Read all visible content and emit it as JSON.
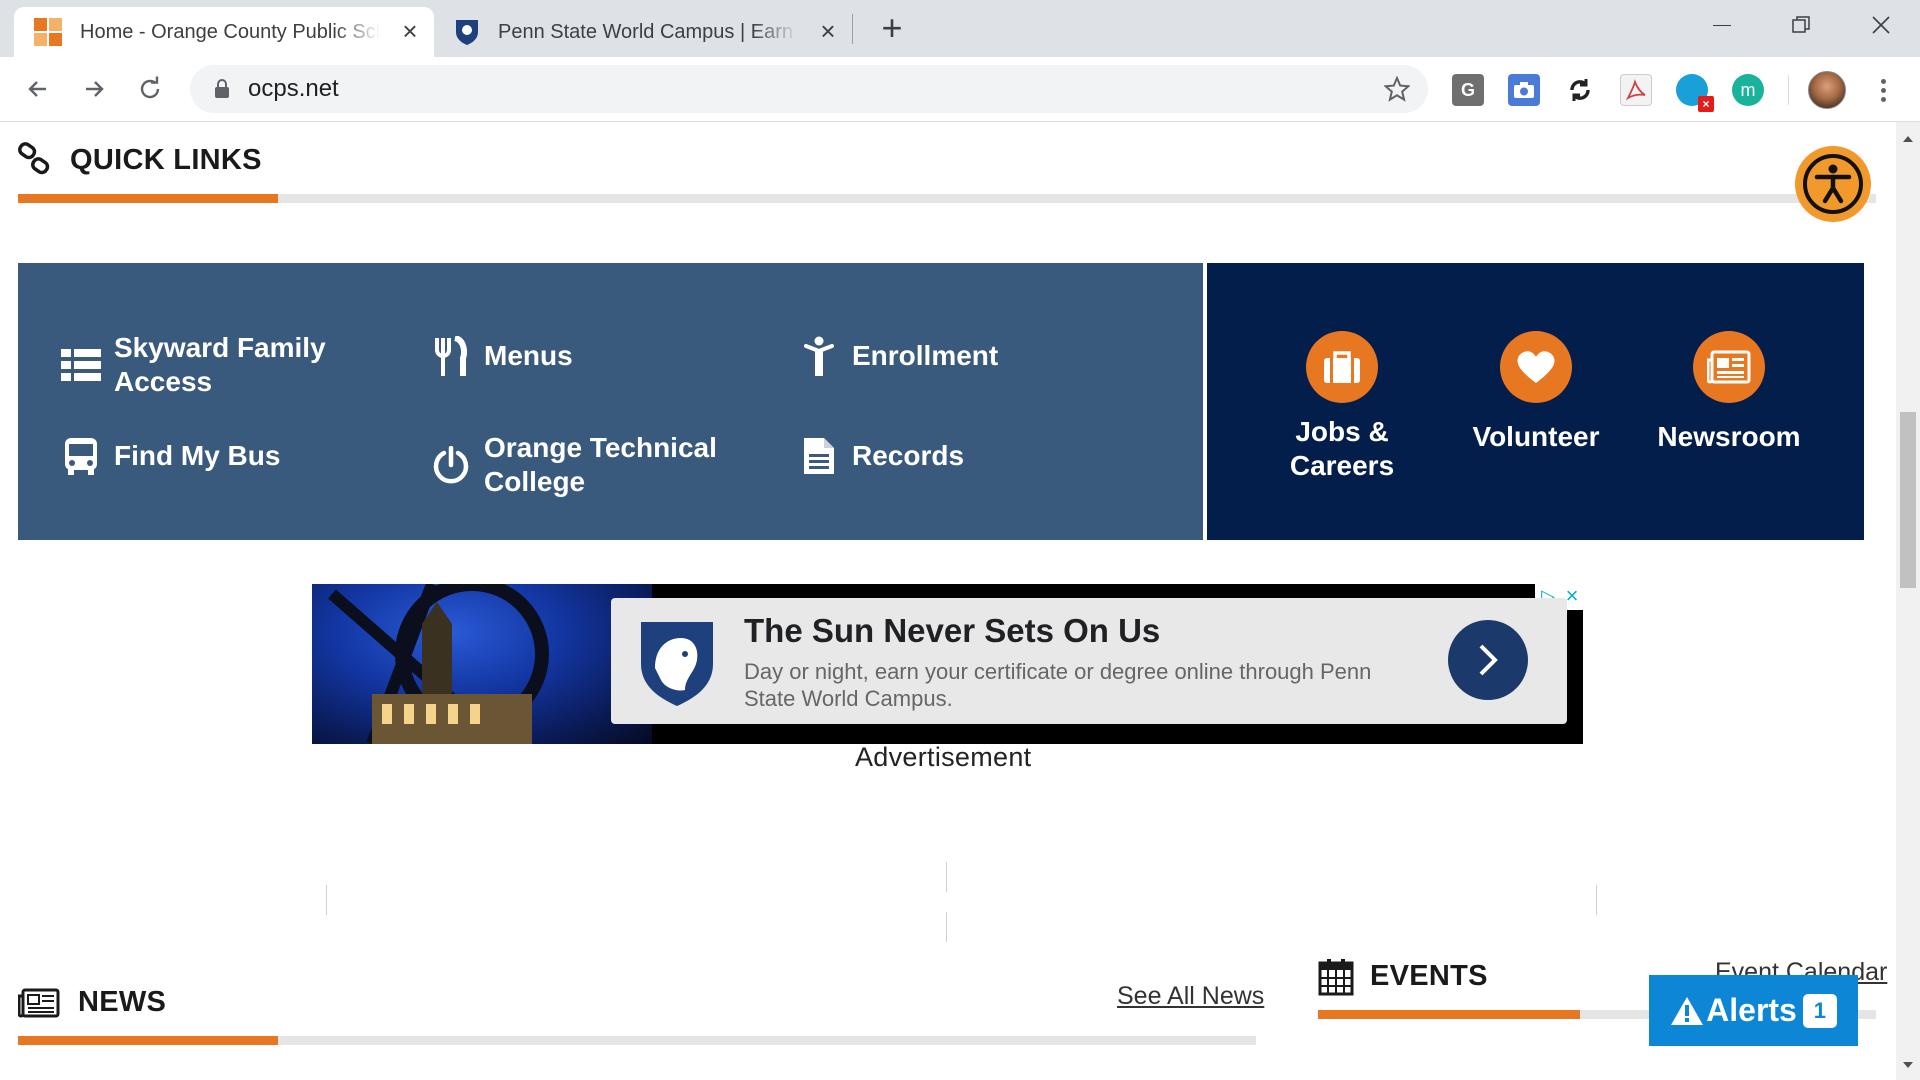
{
  "browser": {
    "tabs": [
      {
        "title": "Home - Orange County Public Schools",
        "active": true
      },
      {
        "title": "Penn State World Campus | Earn Your Degree",
        "active": false
      }
    ],
    "new_tab_label": "+",
    "url": "ocps.net"
  },
  "extensions": [
    {
      "name": "G",
      "color": "#6f6f6f"
    },
    {
      "name": "camera",
      "color": "#4a7bd6"
    },
    {
      "name": "sync",
      "color": "#222222"
    },
    {
      "name": "pdf",
      "color": "#d04242"
    },
    {
      "name": "ext-blue",
      "color": "#1aa0d8"
    },
    {
      "name": "m",
      "color": "#19b39b"
    }
  ],
  "quick_links": {
    "title": "QUICK LINKS",
    "progress": 0.14,
    "items": [
      {
        "label": "Skyward Family Access",
        "icon": "list-icon"
      },
      {
        "label": "Menus",
        "icon": "utensils-icon"
      },
      {
        "label": "Enrollment",
        "icon": "person-icon"
      },
      {
        "label": "Find My Bus",
        "icon": "bus-icon"
      },
      {
        "label": "Orange Technical College",
        "icon": "power-icon"
      },
      {
        "label": "Records",
        "icon": "document-icon"
      }
    ],
    "featured": [
      {
        "label": "Jobs & Careers",
        "icon": "briefcase-icon"
      },
      {
        "label": "Volunteer",
        "icon": "heart-icon"
      },
      {
        "label": "Newsroom",
        "icon": "newspaper-icon"
      }
    ]
  },
  "ad": {
    "headline": "The Sun Never Sets On Us",
    "description": "Day or night, earn your certificate or degree online through Penn State World Campus.",
    "label": "Advertisement"
  },
  "news": {
    "title": "NEWS",
    "link": "See All News",
    "progress": 0.21
  },
  "events": {
    "title": "EVENTS",
    "link": "Event Calendar",
    "progress": 0.47
  },
  "alerts": {
    "label": "Alerts",
    "count": "1"
  },
  "colors": {
    "orange": "#e87722",
    "ql_blue": "#3a5a7d",
    "navy": "#031e4a",
    "alert_blue": "#0d86d6"
  }
}
